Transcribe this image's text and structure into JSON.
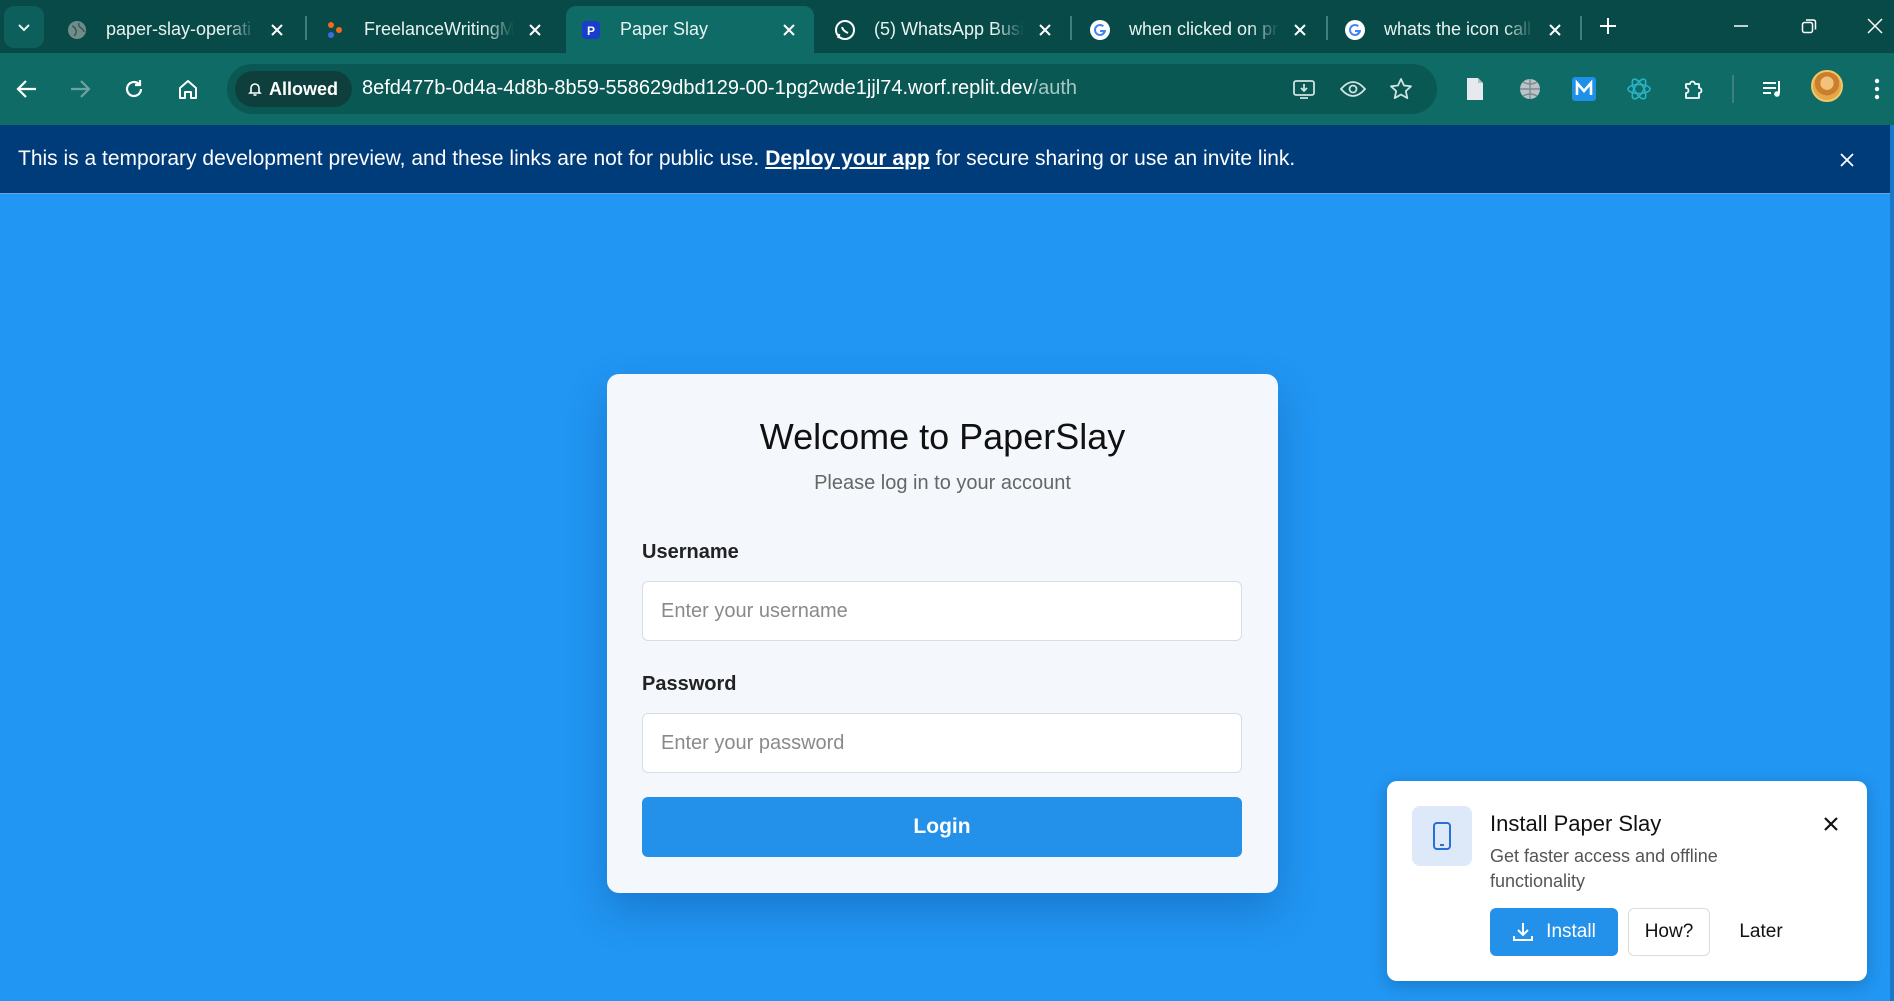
{
  "tabs": [
    {
      "title": "paper-slay-operati",
      "favicon": "globe-icon"
    },
    {
      "title": "FreelanceWritingM",
      "favicon": "freelance-logo-icon"
    },
    {
      "title": "Paper Slay",
      "favicon": "paper-slay-icon",
      "active": true
    },
    {
      "title": "(5) WhatsApp Busi",
      "favicon": "whatsapp-icon"
    },
    {
      "title": "when clicked on pr",
      "favicon": "google-icon"
    },
    {
      "title": "whats the icon call",
      "favicon": "google-icon"
    }
  ],
  "omnibox": {
    "permission_chip": "Allowed",
    "url_host": "8efd477b-0d4a-4d8b-8b59-558629dbd129-00-1pg2wde1jjl74.worf.replit.dev",
    "url_path": "/auth"
  },
  "banner": {
    "text_before": "This is a temporary development preview, and these links are not for public use.",
    "link": "Deploy your app",
    "text_after": "for secure sharing or use an invite link."
  },
  "login": {
    "title": "Welcome to PaperSlay",
    "subtitle": "Please log in to your account",
    "username_label": "Username",
    "username_placeholder": "Enter your username",
    "password_label": "Password",
    "password_placeholder": "Enter your password",
    "button": "Login"
  },
  "install_prompt": {
    "title": "Install Paper Slay",
    "description": "Get faster access and offline functionality",
    "install_button": "Install",
    "how_button": "How?",
    "later_button": "Later"
  },
  "colors": {
    "page_background": "#2196f3",
    "tab_strip": "#074a47",
    "toolbar": "#0e6b66",
    "banner": "#003b7a",
    "primary_button": "#2390ea"
  }
}
